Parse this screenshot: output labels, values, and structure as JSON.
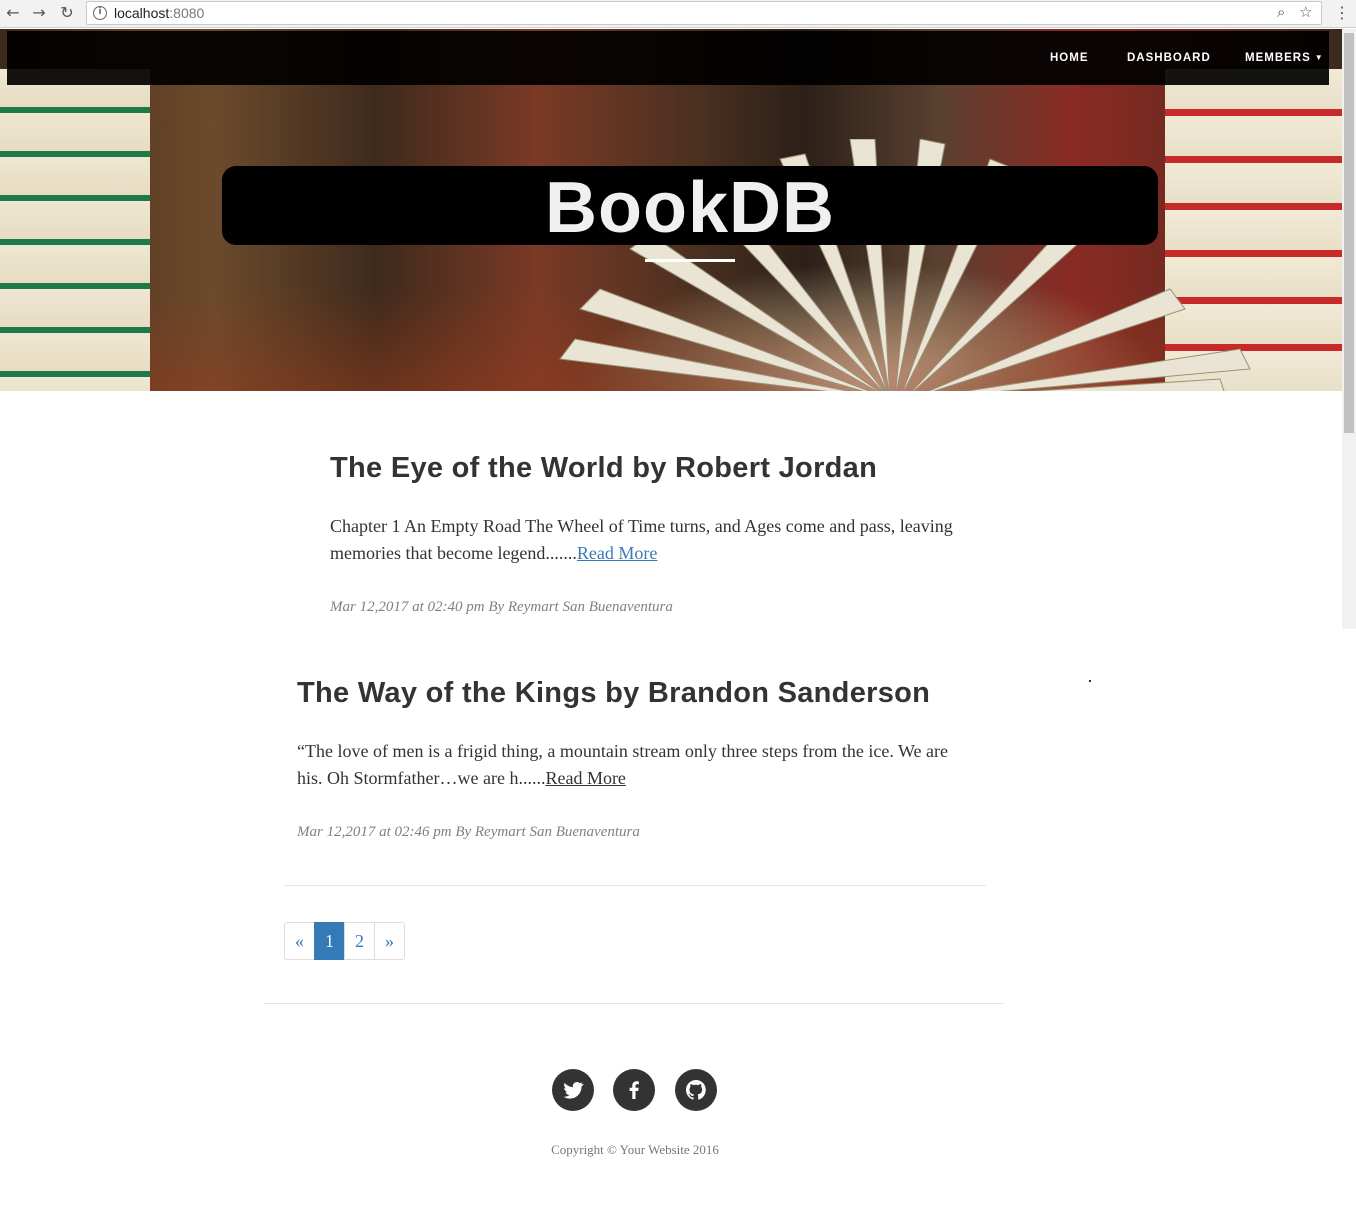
{
  "browser": {
    "url_host": "localhost",
    "url_port": ":8080"
  },
  "nav": {
    "items": [
      {
        "label": "HOME"
      },
      {
        "label": "DASHBOARD"
      },
      {
        "label": "MEMBERS"
      }
    ]
  },
  "hero": {
    "title": "BookDB"
  },
  "posts": [
    {
      "title": "The Eye of the World by Robert Jordan",
      "excerpt": "Chapter 1 An Empty Road The Wheel of Time turns, and Ages come and pass, leaving memories that become legend.......",
      "read_more": "Read More",
      "meta": "Mar 12,2017 at 02:40 pm By Reymart San Buenaventura"
    },
    {
      "title": "The Way of the Kings by Brandon Sanderson",
      "excerpt": "“The love of men is a frigid thing, a mountain stream only three steps from the ice. We are his. Oh Stormfather…we are h......",
      "read_more": "Read More",
      "meta": "Mar 12,2017 at 02:46 pm By Reymart San Buenaventura"
    }
  ],
  "pagination": {
    "prev": "«",
    "pages": [
      "1",
      "2"
    ],
    "active_page": "1",
    "next": "»"
  },
  "footer": {
    "social": [
      "twitter-icon",
      "facebook-icon",
      "github-icon"
    ],
    "copyright": "Copyright © Your Website 2016"
  },
  "colors": {
    "link": "#337ab7",
    "heading": "#333333",
    "meta": "#808080"
  }
}
